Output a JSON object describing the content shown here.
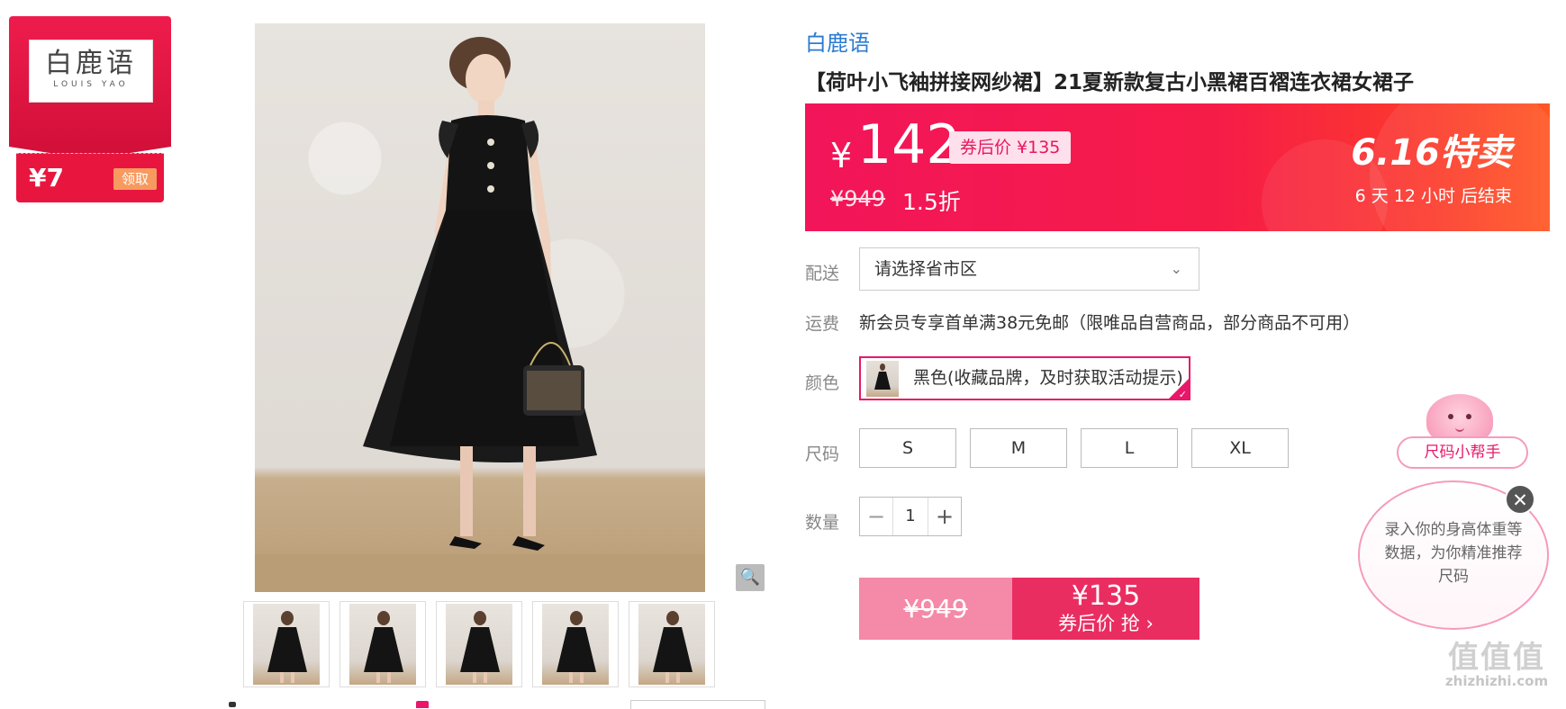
{
  "coupon": {
    "logo_cn": "白鹿语",
    "logo_en": "LOUIS YAO",
    "amount": "¥7",
    "claim_label": "领取"
  },
  "gallery": {
    "zoom_icon": "magnifier-icon",
    "thumbnail_count": 5
  },
  "product": {
    "brand": "白鹿语",
    "title": "【荷叶小飞袖拼接网纱裙】21夏新款复古小黑裙百褶连衣裙女裙子"
  },
  "price": {
    "currency": "¥",
    "current": "142",
    "coupon_price": "券后价 ¥135",
    "original": "¥949",
    "discount": "1.5折",
    "promo_title": "6.16特卖",
    "countdown": "6 天 12 小时 后结束",
    "accent_color": "#f61c48"
  },
  "shipping": {
    "label": "配送",
    "region_placeholder": "请选择省市区",
    "fee_label": "运费",
    "fee_text": "新会员专享首单满38元免邮（限唯品自营商品，部分商品不可用）"
  },
  "color": {
    "label": "颜色",
    "selected": "黑色(收藏品牌，及时获取活动提示)"
  },
  "size": {
    "label": "尺码",
    "options": [
      "S",
      "M",
      "L",
      "XL"
    ]
  },
  "quantity": {
    "label": "数量",
    "value": "1",
    "minus": "−",
    "plus": "+"
  },
  "buy": {
    "original": "¥949",
    "price": "¥135",
    "action": "券后价 抢 ›"
  },
  "size_helper": {
    "tag": "尺码小帮手",
    "message": "录入你的身高体重等数据，为你精准推荐尺码",
    "close": "✕"
  },
  "watermark": {
    "main": "值值值",
    "sub": "zhizhizhi.com"
  }
}
